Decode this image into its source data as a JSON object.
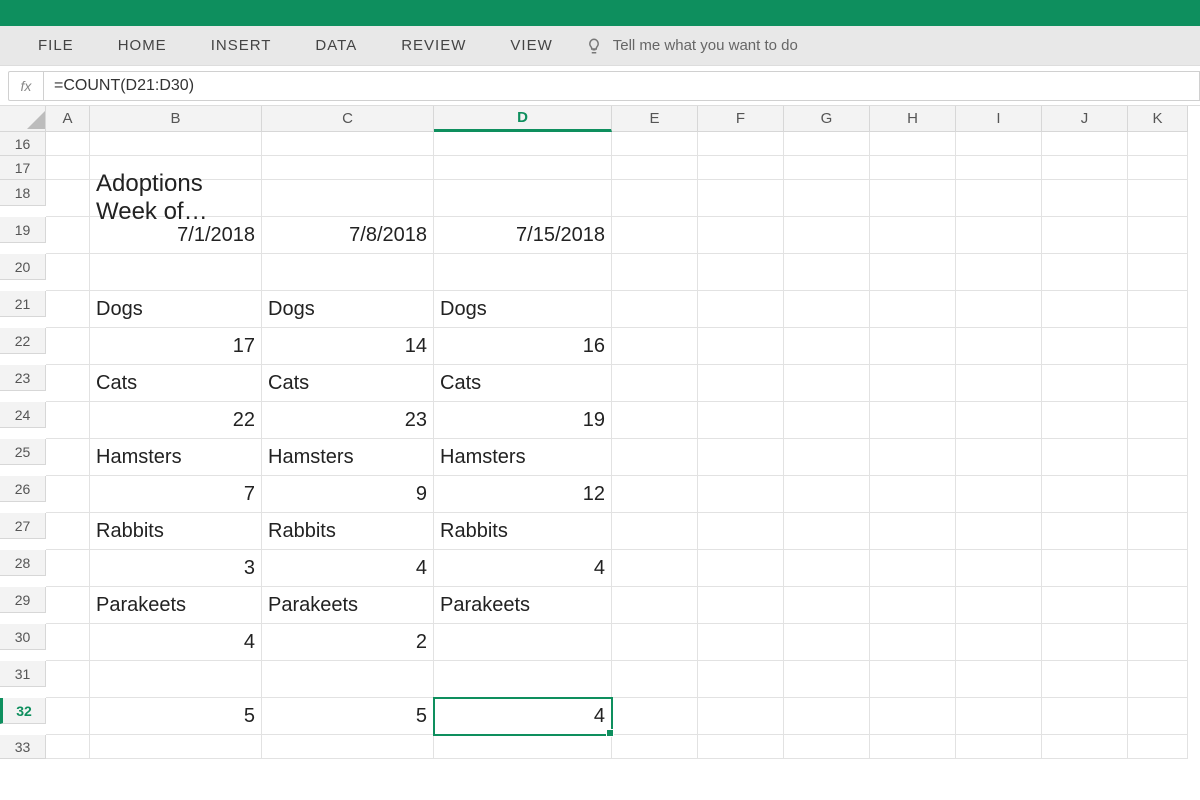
{
  "ribbon": {
    "tabs": [
      "FILE",
      "HOME",
      "INSERT",
      "DATA",
      "REVIEW",
      "VIEW"
    ],
    "tellme_placeholder": "Tell me what you want to do"
  },
  "formula_bar": {
    "fx": "fx",
    "value": "=COUNT(D21:D30)"
  },
  "columns": [
    "A",
    "B",
    "C",
    "D",
    "E",
    "F",
    "G",
    "H",
    "I",
    "J",
    "K"
  ],
  "rows": [
    "16",
    "17",
    "18",
    "19",
    "20",
    "21",
    "22",
    "23",
    "24",
    "25",
    "26",
    "27",
    "28",
    "29",
    "30",
    "31",
    "32",
    "33"
  ],
  "selected": {
    "col": "D",
    "row": "32"
  },
  "cells": {
    "B18": "Adoptions Week of…",
    "B19": "7/1/2018",
    "C19": "7/8/2018",
    "D19": "7/15/2018",
    "B21": "Dogs",
    "C21": "Dogs",
    "D21": "Dogs",
    "B22": "17",
    "C22": "14",
    "D22": "16",
    "B23": "Cats",
    "C23": "Cats",
    "D23": "Cats",
    "B24": "22",
    "C24": "23",
    "D24": "19",
    "B25": "Hamsters",
    "C25": "Hamsters",
    "D25": "Hamsters",
    "B26": "7",
    "C26": "9",
    "D26": "12",
    "B27": "Rabbits",
    "C27": "Rabbits",
    "D27": "Rabbits",
    "B28": "3",
    "C28": "4",
    "D28": "4",
    "B29": "Parakeets",
    "C29": "Parakeets",
    "D29": "Parakeets",
    "B30": "4",
    "C30": "2",
    "B32": "5",
    "C32": "5",
    "D32": "4"
  },
  "right_align": [
    "B19",
    "C19",
    "D19",
    "B22",
    "C22",
    "D22",
    "B24",
    "C24",
    "D24",
    "B26",
    "C26",
    "D26",
    "B28",
    "C28",
    "D28",
    "B30",
    "C30",
    "B32",
    "C32",
    "D32"
  ],
  "big_font": [
    "B18"
  ]
}
